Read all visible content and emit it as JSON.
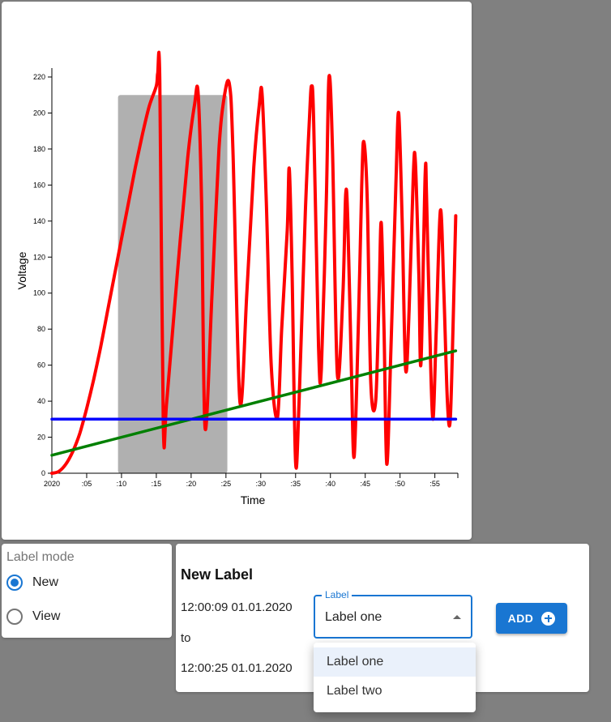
{
  "chart_data": {
    "type": "line",
    "xlabel": "Time",
    "ylabel": "Voltage",
    "x_ticks": [
      "2020",
      ":05",
      ":10",
      ":15",
      ":20",
      ":25",
      ":30",
      ":35",
      ":40",
      ":45",
      ":50",
      ":55"
    ],
    "x_tick_seconds": [
      0,
      5,
      10,
      15,
      20,
      25,
      30,
      35,
      40,
      45,
      50,
      55
    ],
    "y_ticks": [
      0,
      20,
      40,
      60,
      80,
      100,
      120,
      140,
      160,
      180,
      200,
      220
    ],
    "ylim": [
      0,
      225
    ],
    "xlim_seconds": [
      0,
      58
    ],
    "highlight": {
      "x_start": 9.5,
      "x_end": 25.2,
      "y_top": 210,
      "color": "#b0b0b0"
    },
    "series": [
      {
        "color": "#ff0000",
        "points": [
          [
            0,
            0
          ],
          [
            1,
            1
          ],
          [
            2,
            5
          ],
          [
            3,
            12
          ],
          [
            4,
            22
          ],
          [
            5,
            36
          ],
          [
            6,
            52
          ],
          [
            7,
            70
          ],
          [
            8,
            90
          ],
          [
            9,
            110
          ],
          [
            10,
            130
          ],
          [
            11,
            150
          ],
          [
            12,
            170
          ],
          [
            13,
            188
          ],
          [
            14,
            204
          ],
          [
            15,
            215
          ],
          [
            15.2,
            222
          ],
          [
            15.5,
            218
          ],
          [
            16,
            27
          ],
          [
            16.5,
            40
          ],
          [
            18,
            110
          ],
          [
            19.5,
            175
          ],
          [
            20.5,
            205
          ],
          [
            21,
            211
          ],
          [
            21.5,
            150
          ],
          [
            22,
            25
          ],
          [
            23,
            100
          ],
          [
            24,
            180
          ],
          [
            24.8,
            210
          ],
          [
            25.5,
            216
          ],
          [
            26,
            180
          ],
          [
            27,
            40
          ],
          [
            28,
            100
          ],
          [
            29,
            170
          ],
          [
            29.8,
            205
          ],
          [
            30.2,
            210
          ],
          [
            30.8,
            150
          ],
          [
            31.5,
            60
          ],
          [
            32.4,
            31
          ],
          [
            33,
            80
          ],
          [
            33.8,
            135
          ],
          [
            34.1,
            169
          ],
          [
            34.5,
            110
          ],
          [
            35,
            6
          ],
          [
            35.5,
            40
          ],
          [
            36.4,
            145
          ],
          [
            37,
            198
          ],
          [
            37.3,
            215
          ],
          [
            37.6,
            195
          ],
          [
            38.3,
            70
          ],
          [
            38.7,
            58
          ],
          [
            39.4,
            150
          ],
          [
            39.8,
            220
          ],
          [
            40.3,
            180
          ],
          [
            41,
            55
          ],
          [
            41.8,
            100
          ],
          [
            42.2,
            155
          ],
          [
            42.5,
            140
          ],
          [
            43,
            60
          ],
          [
            43.4,
            9
          ],
          [
            44,
            80
          ],
          [
            44.5,
            160
          ],
          [
            44.8,
            184
          ],
          [
            45.3,
            150
          ],
          [
            45.8,
            50
          ],
          [
            46.5,
            40
          ],
          [
            47,
            100
          ],
          [
            47.3,
            139
          ],
          [
            47.7,
            80
          ],
          [
            48.1,
            5
          ],
          [
            48.7,
            70
          ],
          [
            49.4,
            160
          ],
          [
            49.8,
            200
          ],
          [
            50.3,
            140
          ],
          [
            50.8,
            58
          ],
          [
            51.3,
            90
          ],
          [
            51.9,
            165
          ],
          [
            52.2,
            173
          ],
          [
            52.7,
            110
          ],
          [
            53,
            61
          ],
          [
            53.6,
            165
          ],
          [
            53.8,
            155
          ],
          [
            54.2,
            90
          ],
          [
            54.7,
            30
          ],
          [
            55.2,
            80
          ],
          [
            55.8,
            146
          ],
          [
            56.3,
            100
          ],
          [
            56.8,
            40
          ],
          [
            57.2,
            29
          ],
          [
            57.6,
            80
          ],
          [
            58,
            143
          ]
        ]
      },
      {
        "color": "#008000",
        "points": [
          [
            0,
            10
          ],
          [
            58,
            68
          ]
        ]
      },
      {
        "color": "#0000ff",
        "points": [
          [
            0,
            30
          ],
          [
            58,
            30
          ]
        ]
      }
    ]
  },
  "label_mode": {
    "title": "Label mode",
    "options": [
      {
        "label": "New",
        "checked": true
      },
      {
        "label": "View",
        "checked": false
      }
    ]
  },
  "new_label": {
    "title": "New Label",
    "start_time": "12:00:09 01.01.2020",
    "to_text": "to",
    "end_time": "12:00:25 01.01.2020",
    "select_legend": "Label",
    "select_value": "Label one",
    "add_button": "ADD",
    "add_icon": "plus-circle-icon"
  },
  "dropdown": {
    "options": [
      "Label one",
      "Label two"
    ],
    "selected_index": 0
  },
  "colors": {
    "accent": "#1976d2",
    "background": "#808080"
  }
}
